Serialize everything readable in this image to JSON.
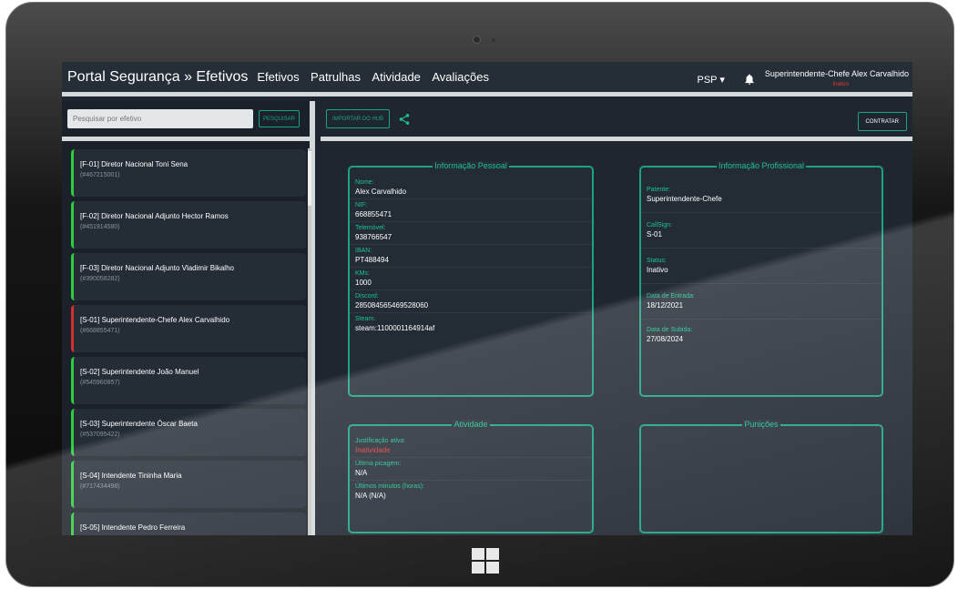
{
  "header": {
    "brand": "Portal Segurança » Efetivos",
    "nav": [
      "Efetivos",
      "Patrulhas",
      "Atividade",
      "Avaliações"
    ],
    "dept": "PSP ▾",
    "user_name": "Superintendente-Chefe Alex Carvalhido",
    "user_status": "Inativo"
  },
  "sidebar": {
    "search_placeholder": "Pesquisar por efetivo",
    "search_button": "PESQUISAR",
    "items": [
      {
        "name": "[F-01] Diretor Nacional Toni Sena",
        "id": "(#467215001)",
        "status": "green"
      },
      {
        "name": "[F-02] Diretor Nacional Adjunto Hector Ramos",
        "id": "(#451914580)",
        "status": "green"
      },
      {
        "name": "[F-03] Diretor Nacional Adjunto Vladimir Bikalho",
        "id": "(#390058282)",
        "status": "green"
      },
      {
        "name": "[S-01] Superintendente-Chefe Alex Carvalhido",
        "id": "(#668855471)",
        "status": "red"
      },
      {
        "name": "[S-02] Superintendente João Manuel",
        "id": "(#545960857)",
        "status": "green"
      },
      {
        "name": "[S-03] Superintendente Óscar Baeta",
        "id": "(#537095422)",
        "status": "green"
      },
      {
        "name": "[S-04] Intendente Tininha Maria",
        "id": "(#717434498)",
        "status": "green"
      },
      {
        "name": "[S-05] Intendente Pedro Ferreira",
        "id": "",
        "status": "green"
      }
    ]
  },
  "toolbar": {
    "import_label": "IMPORTAR DO HUB",
    "hire_label": "CONTRATAR"
  },
  "personal": {
    "title": "Informação Pessoal",
    "fields": [
      {
        "label": "Nome:",
        "value": "Alex Carvalhido"
      },
      {
        "label": "NIF:",
        "value": "668855471"
      },
      {
        "label": "Telemóvel:",
        "value": "938766547"
      },
      {
        "label": "IBAN:",
        "value": "PT488494"
      },
      {
        "label": "KMs:",
        "value": "1000"
      },
      {
        "label": "Discord:",
        "value": "285084565469528060"
      },
      {
        "label": "Steam:",
        "value": "steam:1100001164914af"
      }
    ]
  },
  "professional": {
    "title": "Informação Profissional",
    "fields": [
      {
        "label": "Patente:",
        "value": "Superintendente-Chefe"
      },
      {
        "label": "CallSign:",
        "value": "S-01"
      },
      {
        "label": "Status:",
        "value": "Inativo"
      },
      {
        "label": "Data de Entrada:",
        "value": "18/12/2021"
      },
      {
        "label": "Data de Subida:",
        "value": "27/08/2024"
      }
    ]
  },
  "activity": {
    "title": "Atividade",
    "fields": [
      {
        "label": "Justificação ativa:",
        "value": "Inatividade"
      },
      {
        "label": "Última picagem:",
        "value": "N/A"
      },
      {
        "label": "Últimos minutos (horas):",
        "value": "N/A (N/A)"
      }
    ]
  },
  "punishments": {
    "title": "Punições"
  },
  "colors": {
    "accent": "#1aa37f",
    "inactive": "#e53935",
    "active": "#2ecc40"
  }
}
